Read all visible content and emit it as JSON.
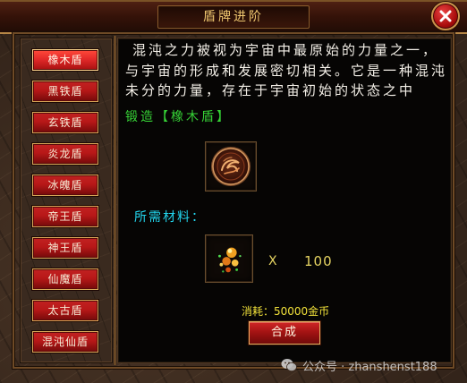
{
  "window": {
    "title": "盾牌进阶",
    "close_icon": "close-icon"
  },
  "shield_list": {
    "items": [
      {
        "label": "橡木盾",
        "selected": true
      },
      {
        "label": "黑铁盾"
      },
      {
        "label": "玄铁盾"
      },
      {
        "label": "炎龙盾"
      },
      {
        "label": "冰魄盾"
      },
      {
        "label": "帝王盾"
      },
      {
        "label": "神王盾"
      },
      {
        "label": "仙魔盾"
      },
      {
        "label": "太古盾"
      },
      {
        "label": "混沌仙盾"
      }
    ]
  },
  "detail": {
    "description_lines": [
      "混沌之力被视为宇宙中最原始的力量之一，",
      "与宇宙的形成和发展密切相关。它是一种混沌",
      "未分的力量，存在于宇宙初始的状态之中"
    ],
    "forge_text": "锻造【橡木盾】",
    "result_item_icon": "round-shield-icon",
    "materials_label": "所需材料：",
    "material": {
      "icon": "golden-ore-icon",
      "multiplier": "X",
      "quantity": "100"
    },
    "cost_text": "消耗：50000金币",
    "craft_button_label": "合成"
  },
  "watermark": {
    "icon": "wechat-icon",
    "text": "公众号 · zhanshenst188"
  },
  "colors": {
    "title_text": "#f0c870",
    "description_text": "#f4f0e8",
    "forge_text": "#36d236",
    "materials_text": "#22d6ee",
    "quantity_text": "#e6d462",
    "cost_text": "#f2e23a",
    "button_red": "#b81818",
    "selected_button_red": "#e42a2a",
    "frame_gold": "#c8944c"
  }
}
